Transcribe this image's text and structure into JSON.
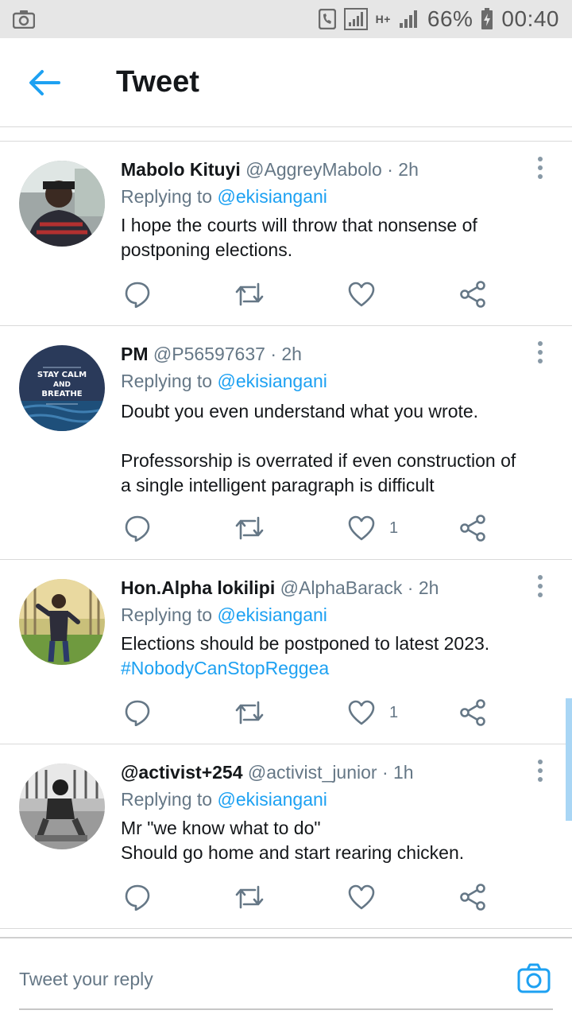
{
  "status_bar": {
    "battery": "66%",
    "time": "00:40",
    "network": "H+"
  },
  "header": {
    "title": "Tweet"
  },
  "tweets": [
    {
      "name": "Mabolo Kituyi",
      "handle": "@AggreyMabolo",
      "time": "· 2h",
      "replying_prefix": "Replying to",
      "replying_to": "@ekisiangani",
      "lines": [
        "I hope the courts will throw that nonsense of",
        "postponing elections."
      ],
      "likes": ""
    },
    {
      "name": "PM",
      "handle": "@P56597637",
      "time": "· 2h",
      "replying_prefix": "Replying to",
      "replying_to": "@ekisiangani",
      "lines": [
        "Doubt you even understand what you wrote.",
        "",
        "Professorship is overrated if even construction of",
        "a single intelligent paragraph is difficult"
      ],
      "likes": "1",
      "avatar_text": [
        "STAY CALM",
        "AND",
        "BREATHE"
      ]
    },
    {
      "name": "Hon.Alpha lokilipi",
      "handle": "@AlphaBarack",
      "time": "· 2h",
      "replying_prefix": "Replying to",
      "replying_to": "@ekisiangani",
      "lines": [
        "Elections should be postponed to latest 2023."
      ],
      "hashtag": "#NobodyCanStopReggea",
      "likes": "1"
    },
    {
      "name": "@activist+254",
      "handle": "@activist_junior",
      "time": "· 1h",
      "replying_prefix": "Replying to",
      "replying_to": "@ekisiangani",
      "lines": [
        "Mr \"we know what to do\"",
        "Should go home and start rearing chicken."
      ],
      "likes": ""
    }
  ],
  "reply_bar": {
    "placeholder": "Tweet your reply"
  },
  "colors": {
    "accent": "#1da1f2",
    "secondary_text": "#657786",
    "divider": "#d9d9d9",
    "status_bar_bg": "#e6e6e6"
  }
}
